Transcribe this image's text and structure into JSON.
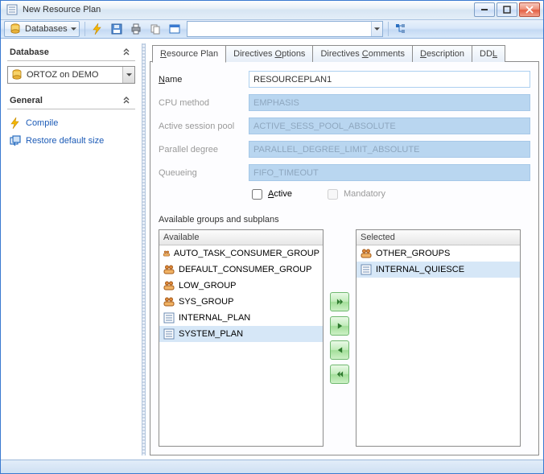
{
  "window": {
    "title": "New Resource Plan"
  },
  "toolbar": {
    "databases_label": "Databases",
    "combo_value": ""
  },
  "sidebar": {
    "database_header": "Database",
    "database_selected": "ORTOZ on DEMO",
    "general_header": "General",
    "general_items": [
      {
        "label": "Compile",
        "name": "compile",
        "icon": "bolt"
      },
      {
        "label": "Restore default size",
        "name": "restore-default-size",
        "icon": "restore"
      }
    ]
  },
  "tabs": [
    {
      "label_pre": "",
      "ul": "R",
      "label_post": "esource Plan",
      "name": "resource-plan",
      "active": true
    },
    {
      "label_pre": "Directives ",
      "ul": "O",
      "label_post": "ptions",
      "name": "directives-options",
      "active": false
    },
    {
      "label_pre": "Directives ",
      "ul": "C",
      "label_post": "omments",
      "name": "directives-comments",
      "active": false
    },
    {
      "label_pre": "",
      "ul": "D",
      "label_post": "escription",
      "name": "description",
      "active": false
    },
    {
      "label_pre": "DD",
      "ul": "L",
      "label_post": "",
      "name": "ddl",
      "active": false
    }
  ],
  "form": {
    "name_label_pre": "",
    "name_label_ul": "N",
    "name_label_post": "ame",
    "name_value": "RESOURCEPLAN1",
    "cpu_label": "CPU method",
    "cpu_value": "EMPHASIS",
    "pool_label": "Active session pool",
    "pool_value": "ACTIVE_SESS_POOL_ABSOLUTE",
    "parallel_label": "Parallel degree",
    "parallel_value": "PARALLEL_DEGREE_LIMIT_ABSOLUTE",
    "queue_label": "Queueing",
    "queue_value": "FIFO_TIMEOUT",
    "active_label_ul": "A",
    "active_label_post": "ctive",
    "mandatory_label": "Mandatory"
  },
  "dual": {
    "section_label": "Available groups and subplans",
    "available_header": "Available",
    "selected_header": "Selected",
    "available": [
      {
        "label": "AUTO_TASK_CONSUMER_GROUP",
        "icon": "group"
      },
      {
        "label": "DEFAULT_CONSUMER_GROUP",
        "icon": "group"
      },
      {
        "label": "LOW_GROUP",
        "icon": "group"
      },
      {
        "label": "SYS_GROUP",
        "icon": "group"
      },
      {
        "label": "INTERNAL_PLAN",
        "icon": "plan"
      },
      {
        "label": "SYSTEM_PLAN",
        "icon": "plan",
        "selected": true
      }
    ],
    "selected": [
      {
        "label": "OTHER_GROUPS",
        "icon": "group"
      },
      {
        "label": "INTERNAL_QUIESCE",
        "icon": "plan",
        "selected": true
      }
    ]
  }
}
